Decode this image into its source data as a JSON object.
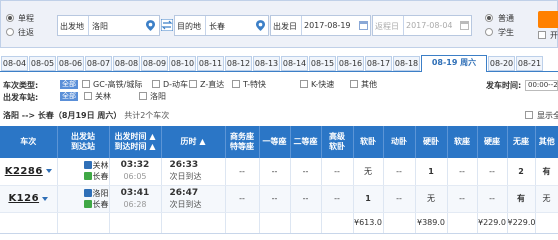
{
  "search": {
    "trip_type": [
      {
        "label": "单程",
        "checked": true
      },
      {
        "label": "往返",
        "checked": false
      }
    ],
    "from_label": "出发地",
    "from_value": "洛阳",
    "to_label": "目的地",
    "to_value": "长春",
    "depart_label": "出发日",
    "depart_value": "2017-08-19",
    "return_label": "返程日",
    "return_value": "2017-08-04",
    "ticket_type": [
      {
        "label": "普通",
        "checked": true
      },
      {
        "label": "学生",
        "checked": false
      }
    ],
    "extra_option_label": "开"
  },
  "date_tabs": {
    "items": [
      "08-04",
      "08-05",
      "08-06",
      "08-07",
      "08-08",
      "08-09",
      "08-10",
      "08-11",
      "08-12",
      "08-13",
      "08-14",
      "08-15",
      "08-16",
      "08-17",
      "08-18",
      "08-19 周六",
      "08-20",
      "08-21"
    ],
    "active": "08-19 周六"
  },
  "filters": {
    "train_type_label": "车次类型:",
    "station_label": "出发车站:",
    "all_label": "全部",
    "train_types": [
      "GC-高铁/城际",
      "D-动车",
      "Z-直达",
      "T-特快",
      "K-快速",
      "其他"
    ],
    "stations": [
      "关林",
      "洛阳"
    ],
    "depart_time_label": "发车时间:",
    "depart_time_value": "00:00--24:00",
    "show_all_label": "显示全"
  },
  "summary": {
    "route": "洛阳 --> 长春（8月19日  周六）",
    "count": "共计2个车次"
  },
  "table": {
    "headers": [
      {
        "label": "车次",
        "sub": ""
      },
      {
        "label": "出发站",
        "sub": "到达站"
      },
      {
        "label": "出发时间 ▲",
        "sub": "到达时间 ▲"
      },
      {
        "label": "历时 ▲",
        "sub": ""
      },
      {
        "label": "商务座",
        "sub": "特等座"
      },
      {
        "label": "一等座",
        "sub": ""
      },
      {
        "label": "二等座",
        "sub": ""
      },
      {
        "label": "高级",
        "sub": "软卧"
      },
      {
        "label": "软卧",
        "sub": ""
      },
      {
        "label": "动卧",
        "sub": ""
      },
      {
        "label": "硬卧",
        "sub": ""
      },
      {
        "label": "软座",
        "sub": ""
      },
      {
        "label": "硬座",
        "sub": ""
      },
      {
        "label": "无座",
        "sub": ""
      },
      {
        "label": "其他",
        "sub": ""
      }
    ],
    "trains": [
      {
        "code": "K2286",
        "from_station": "关林",
        "to_station": "长春",
        "depart_time": "03:32",
        "arrive_time": "06:05",
        "duration": "26:33",
        "arrive_note": "次日到达",
        "seats": [
          "--",
          "--",
          "--",
          "--",
          "无",
          "--",
          "1",
          "--",
          "--",
          "2",
          "有",
          "--"
        ]
      },
      {
        "code": "K126",
        "from_station": "洛阳",
        "to_station": "长春",
        "depart_time": "03:41",
        "arrive_time": "06:28",
        "duration": "26:47",
        "arrive_note": "次日到达",
        "seats": [
          "--",
          "--",
          "--",
          "--",
          "1",
          "--",
          "无",
          "--",
          "--",
          "有",
          "无",
          "--"
        ]
      }
    ],
    "prices": [
      "",
      "",
      "",
      "",
      "",
      "",
      "",
      "",
      "¥613.0",
      "",
      "¥389.0",
      "",
      "¥229.0",
      "¥229.0",
      ""
    ]
  },
  "colors": {
    "header_blue": "#2b76c6",
    "accent_orange": "#ff8000",
    "price_orange": "#ff7300",
    "available_green": "#2e9e2e"
  }
}
